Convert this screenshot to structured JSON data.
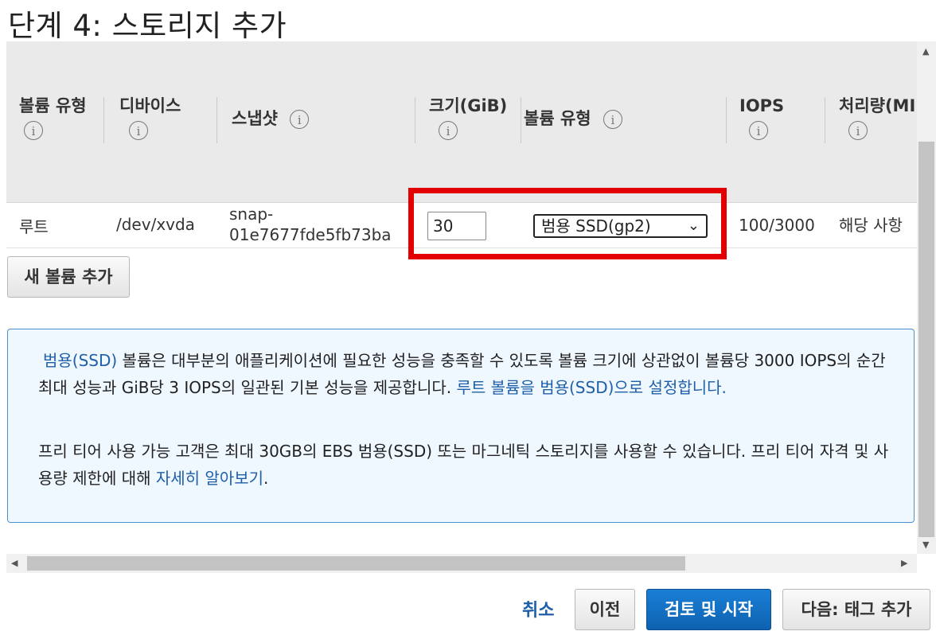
{
  "page": {
    "title": "단계 4: 스토리지 추가"
  },
  "table": {
    "headers": {
      "volume_type": "볼륨 유형",
      "device": "디바이스",
      "snapshot": "스냅샷",
      "size": "크기(GiB)",
      "volume_kind": "볼륨 유형",
      "iops": "IOPS",
      "throughput": "처리량(MI"
    },
    "info_glyph": "i",
    "rows": [
      {
        "volume_type": "루트",
        "device": "/dev/xvda",
        "snapshot_line1": "snap-",
        "snapshot_line2": "01e7677fde5fb73ba",
        "size": "30",
        "volume_kind": "범용 SSD(gp2)",
        "iops": "100/3000",
        "throughput": "해당 사항"
      }
    ]
  },
  "buttons": {
    "add_volume": "새 볼륨 추가",
    "cancel": "취소",
    "previous": "이전",
    "review_launch": "검토 및 시작",
    "next_tags": "다음: 태그 추가"
  },
  "info": {
    "p1_link1": "범용(SSD)",
    "p1_text1": " 볼륨은 대부분의 애플리케이션에 필요한 성능을 충족할 수 있도록 볼륨 크기에 상관없이 볼륨당 3000 IOPS의 순간 최대 성능과 GiB당 3 IOPS의 일관된 기본 성능을 제공합니다. ",
    "p1_link2": "루트 볼륨을 범용(SSD)으로 설정합니다.",
    "p2_text": "프리 티어 사용 가능 고객은 최대 30GB의 EBS 범용(SSD) 또는 마그네틱 스토리지를 사용할 수 있습니다. 프리 티어 자격 및 사용량 제한에 대해 ",
    "p2_link": "자세히 알아보기",
    "p2_end": "."
  },
  "icons": {
    "info": "info-circle-icon",
    "chevron": "chevron-down-icon",
    "scroll_up": "arrow-up-icon",
    "scroll_down": "arrow-down-icon",
    "scroll_left": "arrow-left-icon",
    "scroll_right": "arrow-right-icon"
  },
  "colors": {
    "highlight": "#e30000",
    "link": "#1f5fa8",
    "primary_button": "#1a7fd6",
    "info_box_bg": "#eff7ff"
  }
}
